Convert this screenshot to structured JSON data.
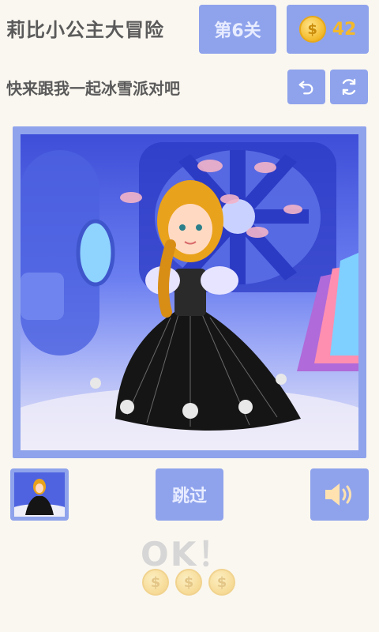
{
  "header": {
    "title": "莉比小公主大冒险",
    "level_label": "第6关",
    "coin_symbol": "$",
    "coin_count": "42"
  },
  "prompt": {
    "text": "快来跟我一起冰雪派对吧",
    "undo_icon": "undo-icon",
    "refresh_icon": "refresh-icon"
  },
  "scene": {
    "description_icon": "princess-scene-image"
  },
  "controls": {
    "thumbnail_icon": "princess-thumbnail",
    "skip_label": "跳过",
    "sound_icon": "speaker-icon"
  },
  "reward": {
    "ok_text": "OK！",
    "coin_symbols": [
      "$",
      "$",
      "$"
    ]
  },
  "colors": {
    "accent": "#8fa3ec",
    "gold": "#f3b92a",
    "background": "#faf7f0",
    "text": "#5a5a5a"
  }
}
